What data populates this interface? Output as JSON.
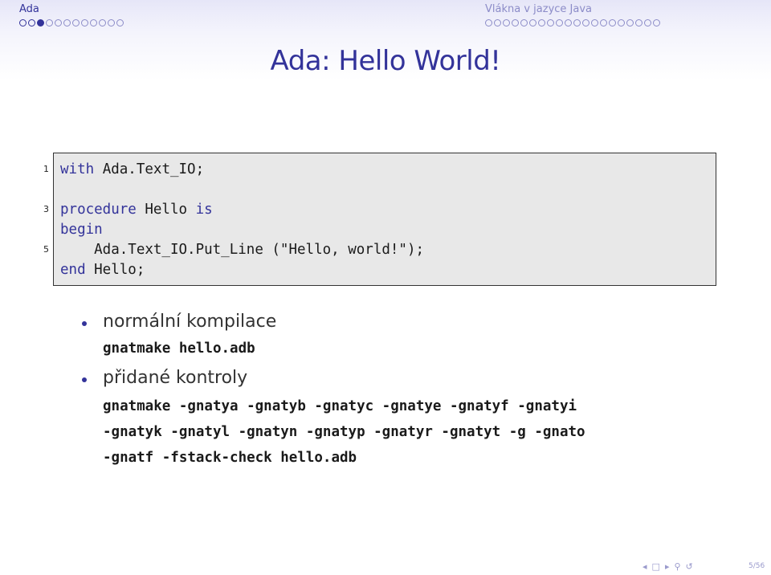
{
  "header": {
    "left_title": "Ada",
    "right_title": "Vlákna v jazyce Java",
    "left_dots": [
      "empty",
      "empty",
      "filled",
      "empty",
      "empty",
      "empty",
      "empty",
      "empty",
      "empty",
      "empty",
      "empty",
      "empty"
    ],
    "right_dots_count": 20
  },
  "slide": {
    "title": "Ada: Hello World!"
  },
  "code": {
    "lines": [
      {
        "no": "1",
        "kw": "with",
        "rest": " Ada.Text_IO;"
      },
      {
        "no": "3",
        "kw": "procedure",
        "rest": " Hello ",
        "kw2": "is"
      },
      {
        "no": "",
        "kw": "begin",
        "rest": ""
      },
      {
        "no": "5",
        "kw": "",
        "rest": "    Ada.Text_IO.Put_Line (\"Hello, world!\");"
      },
      {
        "no": "",
        "kw": "end",
        "rest": " Hello;"
      }
    ]
  },
  "items": [
    {
      "label": "normální kompilace",
      "commands": [
        "gnatmake hello.adb"
      ]
    },
    {
      "label": "přidané kontroly",
      "commands": [
        "gnatmake -gnatya -gnatyb -gnatyc -gnatye -gnatyf -gnatyi",
        "-gnatyk -gnatyl -gnatyn -gnatyp -gnatyr -gnatyt -g -gnato",
        "-gnatf -fstack-check hello.adb"
      ]
    }
  ],
  "footer": {
    "page": "5/56",
    "icons": [
      "arrow-left-icon",
      "frame-icon",
      "arrow-right-icon",
      "search-icon",
      "undo-icon"
    ]
  }
}
